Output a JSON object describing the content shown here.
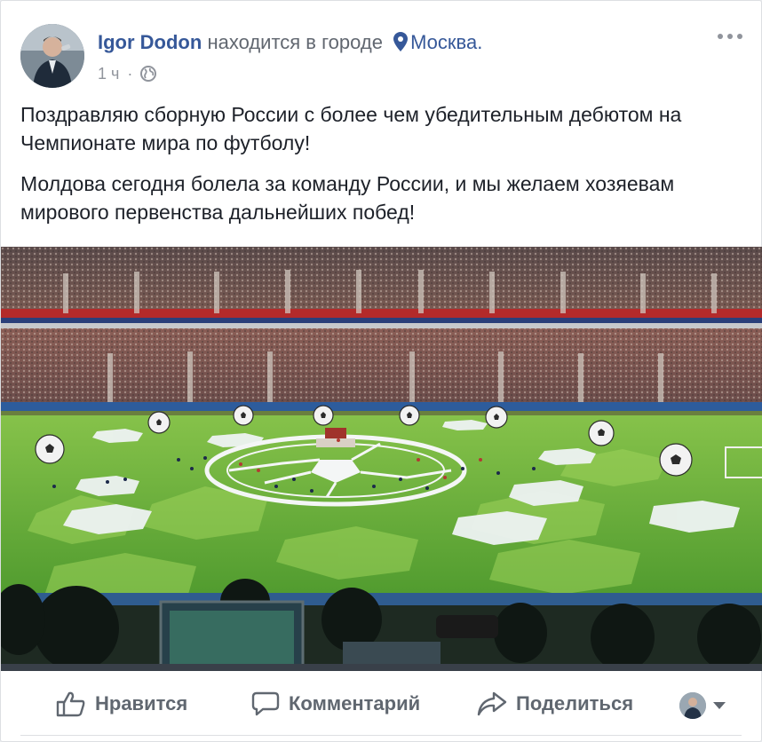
{
  "post": {
    "author": "Igor Dodon",
    "checkin_text": "находится в городе",
    "location": "Москва.",
    "time": "1 ч",
    "separator": "·",
    "privacy_icon": "globe-icon",
    "paragraphs": [
      "Поздравляю сборную России с более чем убедительным дебютом на Чемпионате мира по футболу!",
      "Молдова сегодня болела за команду России, и мы желаем хозяевам мирового первенства дальнейших побед!"
    ]
  },
  "actions": {
    "like_label": "Нравится",
    "comment_label": "Комментарий",
    "share_label": "Поделиться"
  },
  "colors": {
    "link": "#365899",
    "muted": "#90949c",
    "action": "#606770",
    "pitch": "#6fae3a"
  }
}
